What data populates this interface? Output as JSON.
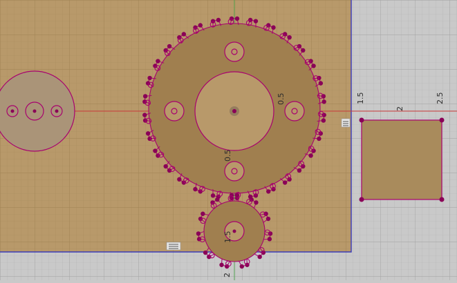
{
  "canvas": {
    "background": "#c9c9c9",
    "grid_minor": "#b4b4b4",
    "grid_major": "#9e9e9e",
    "sketch_plane_fill": "#b8996a",
    "profile_fill": "#a07f4f",
    "sketch_line": "#a8006e",
    "point": "#8a0057",
    "x_axis": "#cc3b3b",
    "y_axis": "#48a048",
    "boundary": "#3a3ab8"
  },
  "dimensions": {
    "circle_right": "0.5",
    "circle_bottom": "0.5",
    "small_gear": "1.5",
    "bottom": "2",
    "ruler_a": "1.5",
    "ruler_b": "2",
    "ruler_c": "2.5"
  },
  "icons": {
    "constraint_right": "horizontal-constraint-icon",
    "constraint_bottom": "horizontal-constraint-icon"
  }
}
